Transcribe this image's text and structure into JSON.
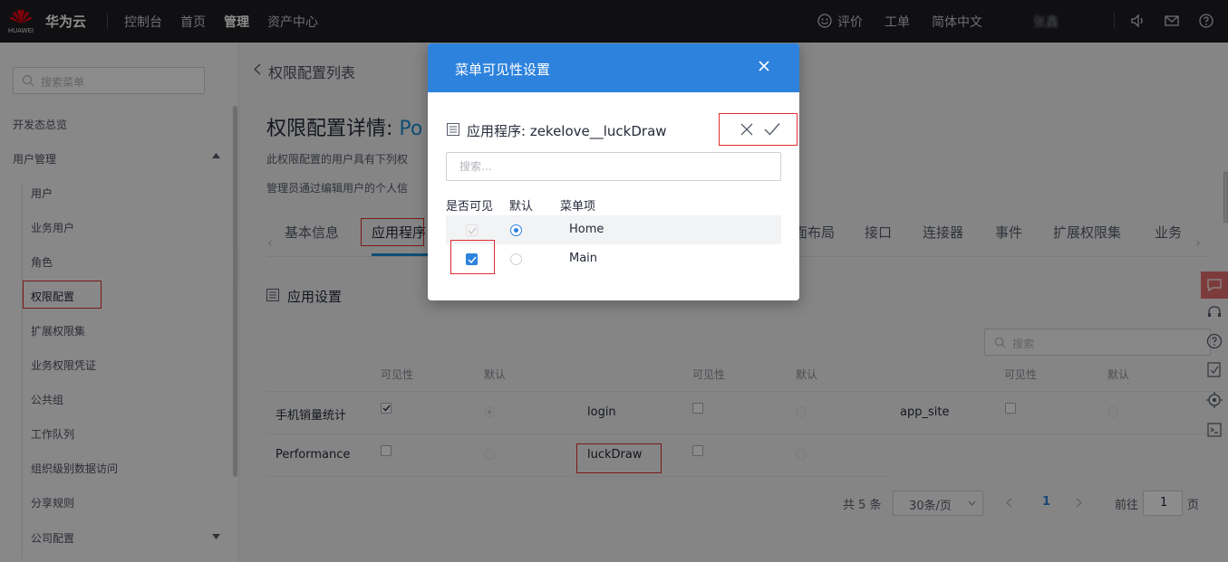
{
  "topbar": {
    "logo_text": "HUAWEI",
    "brand": "华为云",
    "nav": [
      "控制台",
      "首页",
      "管理",
      "资产中心"
    ],
    "active_nav": "管理",
    "right": {
      "feedback": "评价",
      "ticket": "工单",
      "language": "简体中文",
      "user": "张鑫"
    }
  },
  "sidebar": {
    "search_placeholder": "搜索菜单",
    "overview": "开发态总览",
    "user_mgmt": "用户管理",
    "items": [
      "用户",
      "业务用户",
      "角色",
      "权限配置",
      "扩展权限集",
      "业务权限凭证",
      "公共组",
      "工作队列",
      "组织级别数据访问",
      "分享规则"
    ],
    "active_item": "权限配置",
    "company": "公司配置"
  },
  "main": {
    "breadcrumb": "权限配置列表",
    "title_prefix": "权限配置详情: ",
    "title_accent": "Po",
    "desc1": "此权限配置的用户具有下列权",
    "desc2": "管理员通过编辑用户的个人信",
    "tabs": [
      "基本信息",
      "应用程序",
      "页面布局",
      "接口",
      "连接器",
      "事件",
      "扩展权限集",
      "业务"
    ],
    "tab_partial_layout": "面布局",
    "active_tab": "应用程序",
    "section_title": "应用设置",
    "table_search_placeholder": "搜索",
    "col_visible": "可见性",
    "col_default": "默认",
    "rows": [
      {
        "name": "手机销量统计",
        "mid": "login",
        "right": "app_site"
      },
      {
        "name": "Performance",
        "mid": "luckDraw",
        "right": ""
      }
    ],
    "pager": {
      "total": "共 5 条",
      "page_size": "30条/页",
      "current": "1",
      "goto_label": "前往",
      "goto_value": "1",
      "page_unit": "页"
    }
  },
  "modal": {
    "title": "菜单可见性设置",
    "app_label": "应用程序: zekelove__luckDraw",
    "search_placeholder": "搜索...",
    "headers": {
      "visible": "是否可见",
      "default": "默认",
      "menu_item": "菜单项"
    },
    "rows": [
      {
        "label": "Home",
        "visible": true,
        "visible_disabled": true,
        "default": true
      },
      {
        "label": "Main",
        "visible": true,
        "visible_disabled": false,
        "default": false
      }
    ]
  },
  "colors": {
    "accent": "#2c82dd",
    "highlight_box": "#e02d2d",
    "topbar": "#1e1e22"
  }
}
